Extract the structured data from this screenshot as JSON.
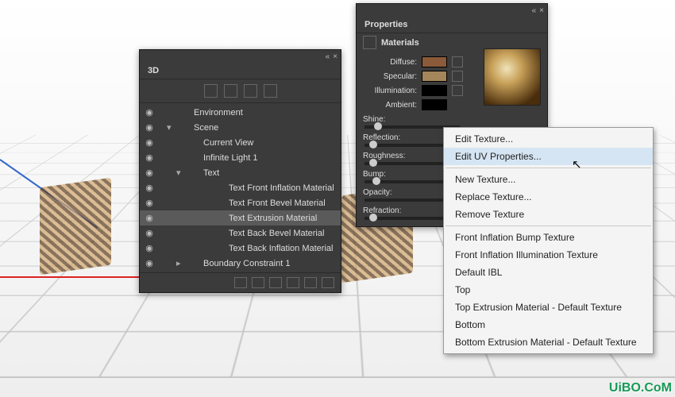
{
  "panel3d": {
    "title": "3D",
    "tabIcons": [
      "cube-icon",
      "mesh-icon",
      "material-icon",
      "light-icon"
    ],
    "tree": [
      {
        "label": "Environment",
        "level": 1,
        "icon": "env-icon",
        "eye": true
      },
      {
        "label": "Scene",
        "level": 1,
        "icon": "scene-icon",
        "eye": true,
        "caret": "▾"
      },
      {
        "label": "Current View",
        "level": 2,
        "icon": "camera-icon",
        "eye": true
      },
      {
        "label": "Infinite Light 1",
        "level": 2,
        "icon": "light-icon",
        "eye": true
      },
      {
        "label": "Text",
        "level": 2,
        "icon": "mesh-icon",
        "eye": true,
        "caret": "▾"
      },
      {
        "label": "Text Front Inflation Material",
        "level": 4,
        "icon": "mat-icon",
        "eye": true
      },
      {
        "label": "Text Front Bevel Material",
        "level": 4,
        "icon": "mat-icon",
        "eye": true
      },
      {
        "label": "Text Extrusion Material",
        "level": 4,
        "icon": "mat-icon",
        "eye": true,
        "selected": true
      },
      {
        "label": "Text Back Bevel Material",
        "level": 4,
        "icon": "mat-icon",
        "eye": true
      },
      {
        "label": "Text Back Inflation Material",
        "level": 4,
        "icon": "mat-icon",
        "eye": true
      },
      {
        "label": "Boundary Constraint 1",
        "level": 2,
        "icon": "constraint-icon",
        "eye": true,
        "caret": "▸"
      }
    ],
    "footerIcons": [
      "light-btn",
      "camera-btn",
      "plane-btn",
      "render-btn",
      "new-btn",
      "delete-btn"
    ]
  },
  "props": {
    "title": "Properties",
    "subtitle": "Materials",
    "rows": {
      "diffuse": {
        "label": "Diffuse:",
        "color": "#8a5a3a"
      },
      "specular": {
        "label": "Specular:",
        "color": "#a5865a"
      },
      "illumination": {
        "label": "Illumination:",
        "color": "#000000"
      },
      "ambient": {
        "label": "Ambient:",
        "color": "#000000"
      }
    },
    "sliders": {
      "shine": "Shine:",
      "reflection": "Reflection:",
      "roughness": "Roughness:",
      "bump": "Bump:",
      "opacity": "Opacity:",
      "refraction": "Refraction:"
    }
  },
  "ctxmenu": {
    "items": [
      {
        "label": "Edit Texture..."
      },
      {
        "label": "Edit UV Properties...",
        "highlight": true
      },
      {
        "sep": true
      },
      {
        "label": "New Texture..."
      },
      {
        "label": "Replace Texture..."
      },
      {
        "label": "Remove Texture"
      },
      {
        "sep": true
      },
      {
        "label": "Front Inflation Bump Texture"
      },
      {
        "label": "Front Inflation Illumination Texture"
      },
      {
        "label": "Default IBL"
      },
      {
        "label": "Top"
      },
      {
        "label": "Top Extrusion Material - Default Texture"
      },
      {
        "label": "Bottom"
      },
      {
        "label": "Bottom Extrusion Material - Default Texture"
      }
    ]
  },
  "watermark": "UiBO.CoM"
}
